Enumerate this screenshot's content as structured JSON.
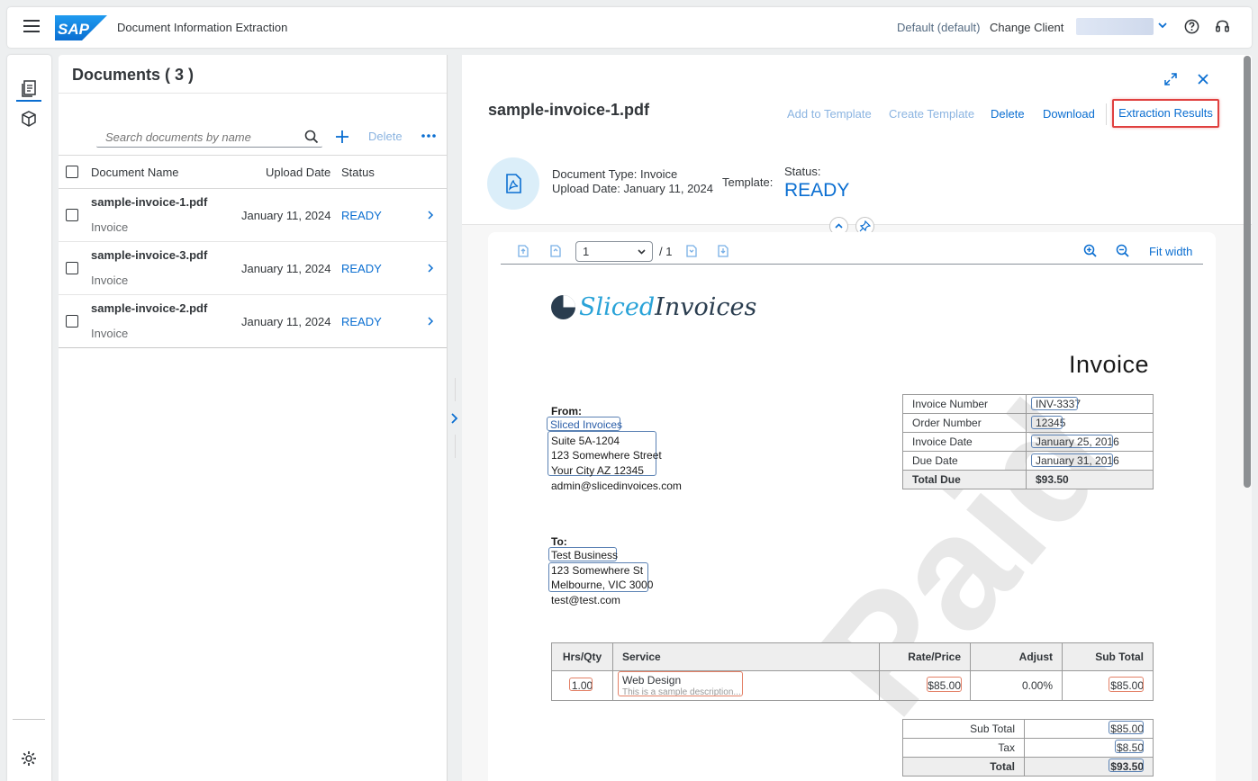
{
  "shell": {
    "app_title": "Document Information Extraction",
    "client_label": "Default (default)",
    "change_client": "Change Client"
  },
  "list": {
    "title": "Documents ( 3 )",
    "search_placeholder": "Search documents by name",
    "delete_label": "Delete",
    "columns": [
      "Document Name",
      "Upload Date",
      "Status"
    ],
    "rows": [
      {
        "name": "sample-invoice-1.pdf",
        "type": "Invoice",
        "date": "January 11, 2024",
        "status": "READY"
      },
      {
        "name": "sample-invoice-3.pdf",
        "type": "Invoice",
        "date": "January 11, 2024",
        "status": "READY"
      },
      {
        "name": "sample-invoice-2.pdf",
        "type": "Invoice",
        "date": "January 11, 2024",
        "status": "READY"
      }
    ]
  },
  "detail": {
    "title": "sample-invoice-1.pdf",
    "toolbar": {
      "add_to_template": "Add to Template",
      "create_template": "Create Template",
      "delete": "Delete",
      "download": "Download",
      "extraction_results": "Extraction Results"
    },
    "meta": {
      "document_type": "Document Type: Invoice",
      "upload_date": "Upload Date: January 11, 2024",
      "template_label": "Template:",
      "status_label": "Status:",
      "status": "READY"
    },
    "viewer": {
      "page": "1",
      "page_total": "/ 1",
      "fit_width": "Fit width"
    }
  },
  "invoice": {
    "logo_part1": "Sliced",
    "logo_part2": "Invoices",
    "heading": "Invoice",
    "from_label": "From:",
    "from_name": "Sliced Invoices",
    "from_addr1": "Suite 5A-1204",
    "from_addr2": "123 Somewhere Street",
    "from_addr3": "Your City AZ 12345",
    "from_email": "admin@slicedinvoices.com",
    "to_label": "To:",
    "to_name": "Test Business",
    "to_addr1": "123 Somewhere St",
    "to_addr2": "Melbourne, VIC 3000",
    "to_email": "test@test.com",
    "info": [
      {
        "label": "Invoice Number",
        "value": "INV-3337"
      },
      {
        "label": "Order Number",
        "value": "12345"
      },
      {
        "label": "Invoice Date",
        "value": "January 25, 2016"
      },
      {
        "label": "Due Date",
        "value": "January 31, 2016"
      },
      {
        "label": "Total Due",
        "value": "$93.50"
      }
    ],
    "items_header": [
      "Hrs/Qty",
      "Service",
      "Rate/Price",
      "Adjust",
      "Sub Total"
    ],
    "item": {
      "qty": "1.00",
      "service": "Web Design",
      "desc": "This is a sample description...",
      "rate": "$85.00",
      "adjust": "0.00%",
      "subtotal": "$85.00"
    },
    "totals": [
      {
        "label": "Sub Total",
        "value": "$85.00"
      },
      {
        "label": "Tax",
        "value": "$8.50"
      },
      {
        "label": "Total",
        "value": "$93.50"
      }
    ],
    "watermark": "Paid"
  }
}
